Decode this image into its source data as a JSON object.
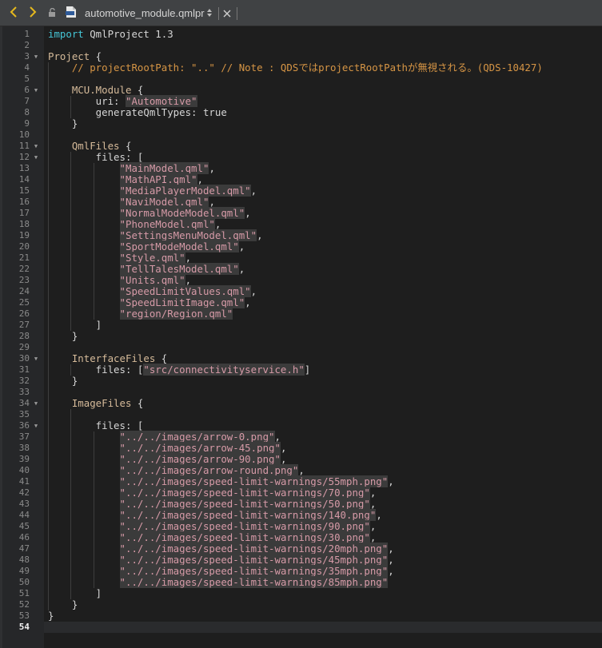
{
  "toolbar": {
    "back_icon": "chevron-left-icon",
    "forward_icon": "chevron-right-icon",
    "lock_icon": "lock-icon",
    "file_icon": "qmlproject-file-icon",
    "filename": "automotive_module.qmlproject",
    "close_icon": "close-icon",
    "accent_color": "#e5b81e"
  },
  "editor": {
    "current_line": 54,
    "lines": [
      [
        {
          "c": "kw",
          "t": "import"
        },
        {
          "c": "",
          "t": " QmlProject 1.3"
        }
      ],
      [],
      [
        {
          "c": "ty",
          "t": "Project"
        },
        {
          "c": "",
          "t": " {"
        }
      ],
      [
        {
          "c": "",
          "t": "    "
        },
        {
          "c": "cm",
          "t": "// projectRootPath: \"..\" // Note : QDSではprojectRootPathが無視される。(QDS-10427)"
        }
      ],
      [],
      [
        {
          "c": "",
          "t": "    "
        },
        {
          "c": "ty",
          "t": "MCU.Module"
        },
        {
          "c": "",
          "t": " {"
        }
      ],
      [
        {
          "c": "",
          "t": "        uri: "
        },
        {
          "c": "str",
          "t": "\"Automotive\""
        }
      ],
      [
        {
          "c": "",
          "t": "        generateQmlTypes: "
        },
        {
          "c": "",
          "t": "true"
        }
      ],
      [
        {
          "c": "",
          "t": "    }"
        }
      ],
      [],
      [
        {
          "c": "",
          "t": "    "
        },
        {
          "c": "ty",
          "t": "QmlFiles"
        },
        {
          "c": "",
          "t": " {"
        }
      ],
      [
        {
          "c": "",
          "t": "        files: ["
        }
      ],
      [
        {
          "c": "",
          "t": "            "
        },
        {
          "c": "str",
          "t": "\"MainModel.qml\""
        },
        {
          "c": "",
          "t": ","
        }
      ],
      [
        {
          "c": "",
          "t": "            "
        },
        {
          "c": "str",
          "t": "\"MathAPI.qml\""
        },
        {
          "c": "",
          "t": ","
        }
      ],
      [
        {
          "c": "",
          "t": "            "
        },
        {
          "c": "str",
          "t": "\"MediaPlayerModel.qml\""
        },
        {
          "c": "",
          "t": ","
        }
      ],
      [
        {
          "c": "",
          "t": "            "
        },
        {
          "c": "str",
          "t": "\"NaviModel.qml\""
        },
        {
          "c": "",
          "t": ","
        }
      ],
      [
        {
          "c": "",
          "t": "            "
        },
        {
          "c": "str",
          "t": "\"NormalModeModel.qml\""
        },
        {
          "c": "",
          "t": ","
        }
      ],
      [
        {
          "c": "",
          "t": "            "
        },
        {
          "c": "str",
          "t": "\"PhoneModel.qml\""
        },
        {
          "c": "",
          "t": ","
        }
      ],
      [
        {
          "c": "",
          "t": "            "
        },
        {
          "c": "str",
          "t": "\"SettingsMenuModel.qml\""
        },
        {
          "c": "",
          "t": ","
        }
      ],
      [
        {
          "c": "",
          "t": "            "
        },
        {
          "c": "str",
          "t": "\"SportModeModel.qml\""
        },
        {
          "c": "",
          "t": ","
        }
      ],
      [
        {
          "c": "",
          "t": "            "
        },
        {
          "c": "str",
          "t": "\"Style.qml\""
        },
        {
          "c": "",
          "t": ","
        }
      ],
      [
        {
          "c": "",
          "t": "            "
        },
        {
          "c": "str",
          "t": "\"TellTalesModel.qml\""
        },
        {
          "c": "",
          "t": ","
        }
      ],
      [
        {
          "c": "",
          "t": "            "
        },
        {
          "c": "str",
          "t": "\"Units.qml\""
        },
        {
          "c": "",
          "t": ","
        }
      ],
      [
        {
          "c": "",
          "t": "            "
        },
        {
          "c": "str",
          "t": "\"SpeedLimitValues.qml\""
        },
        {
          "c": "",
          "t": ","
        }
      ],
      [
        {
          "c": "",
          "t": "            "
        },
        {
          "c": "str",
          "t": "\"SpeedLimitImage.qml\""
        },
        {
          "c": "",
          "t": ","
        }
      ],
      [
        {
          "c": "",
          "t": "            "
        },
        {
          "c": "str",
          "t": "\"region/Region.qml\""
        }
      ],
      [
        {
          "c": "",
          "t": "        ]"
        }
      ],
      [
        {
          "c": "",
          "t": "    }"
        }
      ],
      [],
      [
        {
          "c": "",
          "t": "    "
        },
        {
          "c": "ty",
          "t": "InterfaceFiles"
        },
        {
          "c": "",
          "t": " {"
        }
      ],
      [
        {
          "c": "",
          "t": "        files: ["
        },
        {
          "c": "str",
          "t": "\"src/connectivityservice.h\""
        },
        {
          "c": "",
          "t": "]"
        }
      ],
      [
        {
          "c": "",
          "t": "    }"
        }
      ],
      [],
      [
        {
          "c": "",
          "t": "    "
        },
        {
          "c": "ty",
          "t": "ImageFiles"
        },
        {
          "c": "",
          "t": " {"
        }
      ],
      [],
      [
        {
          "c": "",
          "t": "        files: ["
        }
      ],
      [
        {
          "c": "",
          "t": "            "
        },
        {
          "c": "str",
          "t": "\"../../images/arrow-0.png\""
        },
        {
          "c": "",
          "t": ","
        }
      ],
      [
        {
          "c": "",
          "t": "            "
        },
        {
          "c": "str",
          "t": "\"../../images/arrow-45.png\""
        },
        {
          "c": "",
          "t": ","
        }
      ],
      [
        {
          "c": "",
          "t": "            "
        },
        {
          "c": "str",
          "t": "\"../../images/arrow-90.png\""
        },
        {
          "c": "",
          "t": ","
        }
      ],
      [
        {
          "c": "",
          "t": "            "
        },
        {
          "c": "str",
          "t": "\"../../images/arrow-round.png\""
        },
        {
          "c": "",
          "t": ","
        }
      ],
      [
        {
          "c": "",
          "t": "            "
        },
        {
          "c": "str",
          "t": "\"../../images/speed-limit-warnings/55mph.png\""
        },
        {
          "c": "",
          "t": ","
        }
      ],
      [
        {
          "c": "",
          "t": "            "
        },
        {
          "c": "str",
          "t": "\"../../images/speed-limit-warnings/70.png\""
        },
        {
          "c": "",
          "t": ","
        }
      ],
      [
        {
          "c": "",
          "t": "            "
        },
        {
          "c": "str",
          "t": "\"../../images/speed-limit-warnings/50.png\""
        },
        {
          "c": "",
          "t": ","
        }
      ],
      [
        {
          "c": "",
          "t": "            "
        },
        {
          "c": "str",
          "t": "\"../../images/speed-limit-warnings/140.png\""
        },
        {
          "c": "",
          "t": ","
        }
      ],
      [
        {
          "c": "",
          "t": "            "
        },
        {
          "c": "str",
          "t": "\"../../images/speed-limit-warnings/90.png\""
        },
        {
          "c": "",
          "t": ","
        }
      ],
      [
        {
          "c": "",
          "t": "            "
        },
        {
          "c": "str",
          "t": "\"../../images/speed-limit-warnings/30.png\""
        },
        {
          "c": "",
          "t": ","
        }
      ],
      [
        {
          "c": "",
          "t": "            "
        },
        {
          "c": "str",
          "t": "\"../../images/speed-limit-warnings/20mph.png\""
        },
        {
          "c": "",
          "t": ","
        }
      ],
      [
        {
          "c": "",
          "t": "            "
        },
        {
          "c": "str",
          "t": "\"../../images/speed-limit-warnings/45mph.png\""
        },
        {
          "c": "",
          "t": ","
        }
      ],
      [
        {
          "c": "",
          "t": "            "
        },
        {
          "c": "str",
          "t": "\"../../images/speed-limit-warnings/35mph.png\""
        },
        {
          "c": "",
          "t": ","
        }
      ],
      [
        {
          "c": "",
          "t": "            "
        },
        {
          "c": "str",
          "t": "\"../../images/speed-limit-warnings/85mph.png\""
        }
      ],
      [
        {
          "c": "",
          "t": "        ]"
        }
      ],
      [
        {
          "c": "",
          "t": "    }"
        }
      ],
      [
        {
          "c": "",
          "t": "}"
        }
      ],
      []
    ]
  }
}
